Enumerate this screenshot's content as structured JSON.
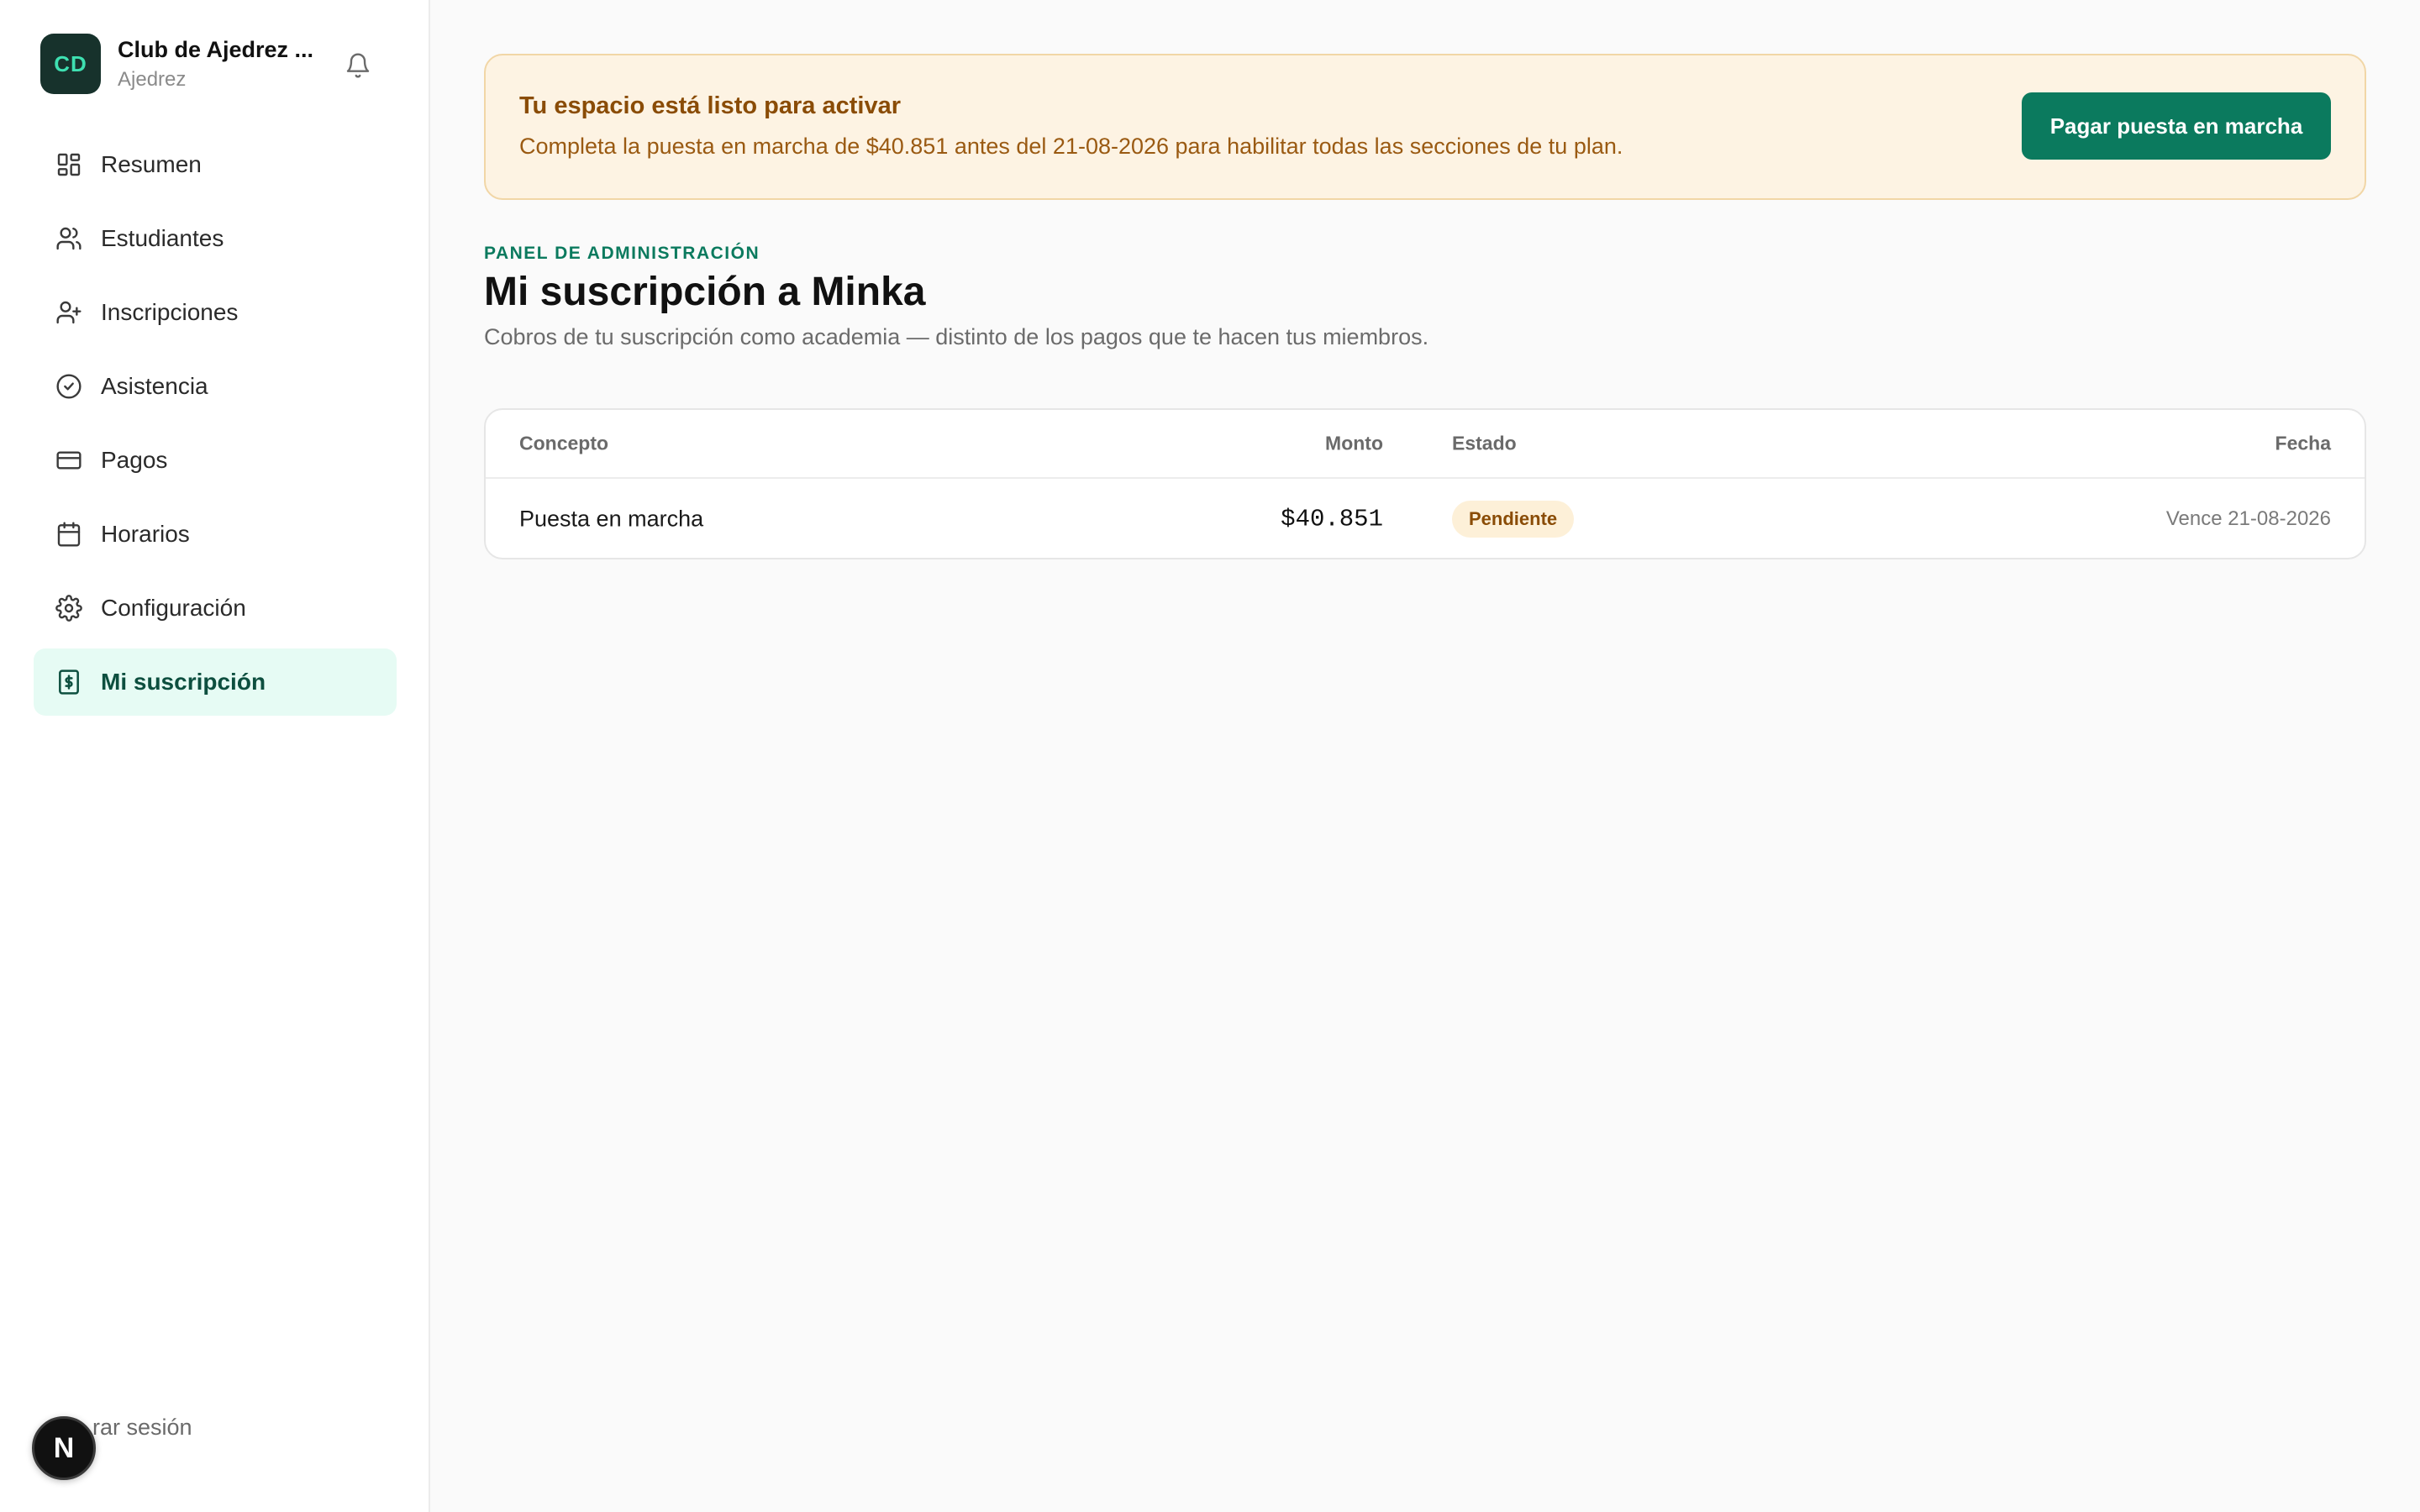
{
  "sidebar": {
    "org": {
      "initials": "CD",
      "name": "Club de Ajedrez ...",
      "subtitle": "Ajedrez"
    },
    "items": [
      {
        "label": "Resumen",
        "icon": "dashboard-icon"
      },
      {
        "label": "Estudiantes",
        "icon": "users-icon"
      },
      {
        "label": "Inscripciones",
        "icon": "user-plus-icon"
      },
      {
        "label": "Asistencia",
        "icon": "check-circle-icon"
      },
      {
        "label": "Pagos",
        "icon": "credit-card-icon"
      },
      {
        "label": "Horarios",
        "icon": "calendar-icon"
      },
      {
        "label": "Configuración",
        "icon": "gear-icon"
      },
      {
        "label": "Mi suscripción",
        "icon": "receipt-dollar-icon",
        "active": true
      }
    ],
    "logout_label": "rar sesión",
    "dev_badge": "N"
  },
  "banner": {
    "title": "Tu espacio está listo para activar",
    "text": "Completa la puesta en marcha de $40.851 antes del 21-08-2026 para habilitar todas las secciones de tu plan.",
    "button_label": "Pagar puesta en marcha"
  },
  "header": {
    "eyebrow": "PANEL DE ADMINISTRACIÓN",
    "title": "Mi suscripción a Minka",
    "subtitle": "Cobros de tu suscripción como academia — distinto de los pagos que te hacen tus miembros."
  },
  "table": {
    "columns": {
      "concept": "Concepto",
      "amount": "Monto",
      "status": "Estado",
      "date": "Fecha"
    },
    "rows": [
      {
        "concept": "Puesta en marcha",
        "amount": "$40.851",
        "status": "Pendiente",
        "date": "Vence 21-08-2026"
      }
    ]
  },
  "colors": {
    "accent": "#0b7a5e",
    "active_nav_bg": "#e6fbf4",
    "banner_bg": "#fdf3e3",
    "warning_text": "#8a4c06"
  }
}
